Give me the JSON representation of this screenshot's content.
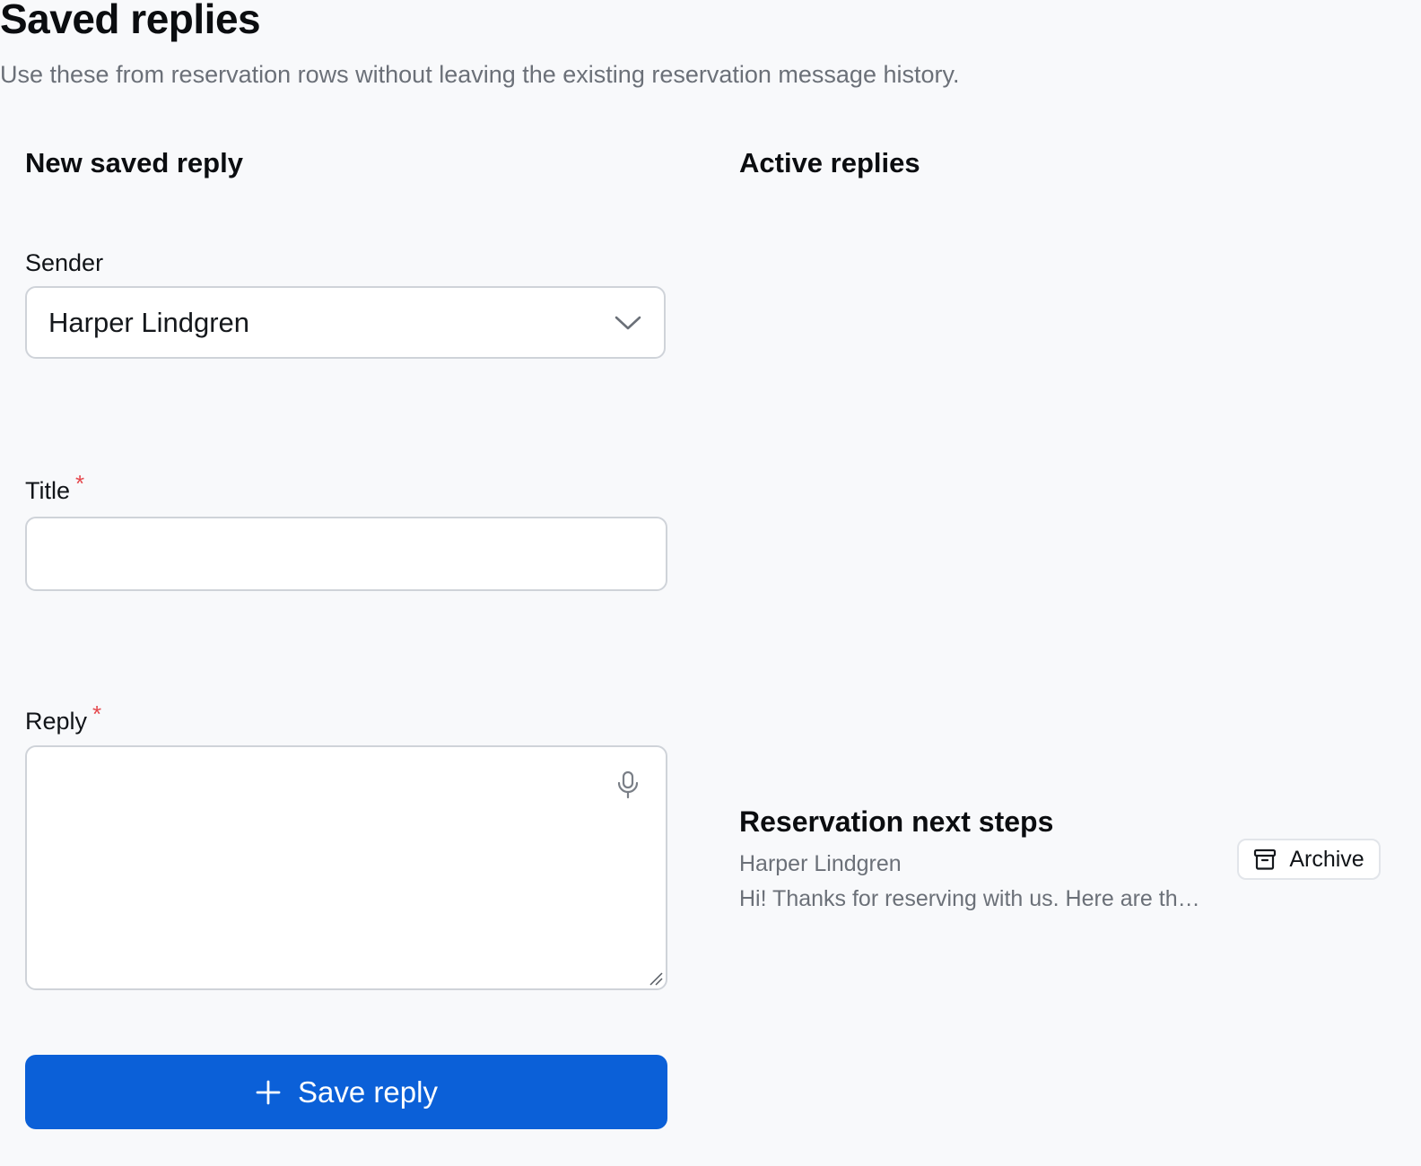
{
  "page": {
    "title": "Saved replies",
    "subtitle": "Use these from reservation rows without leaving the existing reservation message history."
  },
  "form": {
    "heading": "New saved reply",
    "sender": {
      "label": "Sender",
      "value": "Harper Lindgren"
    },
    "title": {
      "label": "Title",
      "required_mark": "*",
      "value": "",
      "placeholder": ""
    },
    "reply": {
      "label": "Reply",
      "required_mark": "*",
      "value": "",
      "placeholder": ""
    },
    "save_button_label": "Save reply"
  },
  "active": {
    "heading": "Active replies",
    "items": [
      {
        "title": "Reservation next steps",
        "sender": "Harper Lindgren",
        "preview": "Hi! Thanks for reserving with us. Here are the n...",
        "archive_label": "Archive"
      }
    ]
  },
  "colors": {
    "primary": "#0b60d8",
    "required": "#e5484d",
    "muted_text": "#6b7078",
    "background": "#f8f9fb"
  },
  "icons": {
    "sender_dropdown": "chevron-down-icon",
    "reply_dictation": "microphone-icon",
    "reply_resize": "resize-grip-icon",
    "save": "plus-icon",
    "archive": "archive-box-icon"
  }
}
